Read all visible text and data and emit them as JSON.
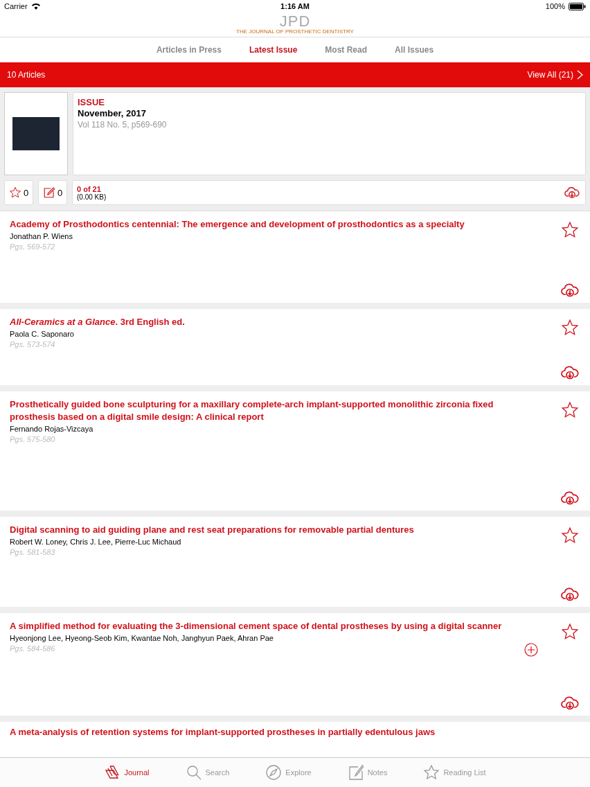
{
  "status_bar": {
    "carrier": "Carrier",
    "time": "1:16 AM",
    "battery": "100%"
  },
  "logo": {
    "letters": "JPD",
    "subtitle": "THE JOURNAL OF PROSTHETIC DENTISTRY"
  },
  "tabs": [
    {
      "label": "Articles in Press",
      "selected": false
    },
    {
      "label": "Latest Issue",
      "selected": true
    },
    {
      "label": "Most Read",
      "selected": false
    },
    {
      "label": "All Issues",
      "selected": false
    }
  ],
  "banner": {
    "count": "10 Articles",
    "view_all": "View All (21)"
  },
  "issue": {
    "label": "ISSUE",
    "date": "November, 2017",
    "volume": "Vol 118 No. 5, p569-690",
    "stars": "0",
    "notes": "0",
    "downloaded": "0 of 21",
    "size": "(0.00 KB)"
  },
  "articles": [
    {
      "title": "Academy of Prosthodontics centennial: The emergence and development of prosthodontics as a specialty",
      "authors": "Jonathan P. Wiens",
      "pages": "Pgs. 569-572",
      "add_button": false
    },
    {
      "title": "*All-Ceramics at a Glance*. 3rd English ed.",
      "authors": "Paola C. Saponaro",
      "pages": "Pgs. 573-574",
      "add_button": false
    },
    {
      "title": "Prosthetically guided bone sculpturing for a maxillary complete-arch implant-supported monolithic zirconia fixed prosthesis based on a digital smile design: A clinical report",
      "authors": "Fernando Rojas-Vizcaya",
      "pages": "Pgs. 575-580",
      "add_button": false
    },
    {
      "title": "Digital scanning to aid guiding plane and rest seat preparations for removable partial dentures",
      "authors": "Robert W. Loney, Chris J. Lee, Pierre-Luc Michaud",
      "pages": "Pgs. 581-583",
      "add_button": false
    },
    {
      "title": "A simplified method for evaluating the 3-dimensional cement space of dental prostheses by using a digital scanner",
      "authors": "Hyeonjong Lee, Hyeong-Seob Kim, Kwantae Noh, Janghyun Paek, Ahran Pae",
      "pages": "Pgs. 584-586",
      "add_button": true
    },
    {
      "title": "A meta-analysis of retention systems for implant-supported prostheses in partially edentulous jaws",
      "kind": "partial"
    }
  ],
  "tab_bar": [
    {
      "label": "Journal",
      "selected": true
    },
    {
      "label": "Search",
      "selected": false
    },
    {
      "label": "Explore",
      "selected": false
    },
    {
      "label": "Notes",
      "selected": false
    },
    {
      "label": "Reading List",
      "selected": false
    }
  ]
}
